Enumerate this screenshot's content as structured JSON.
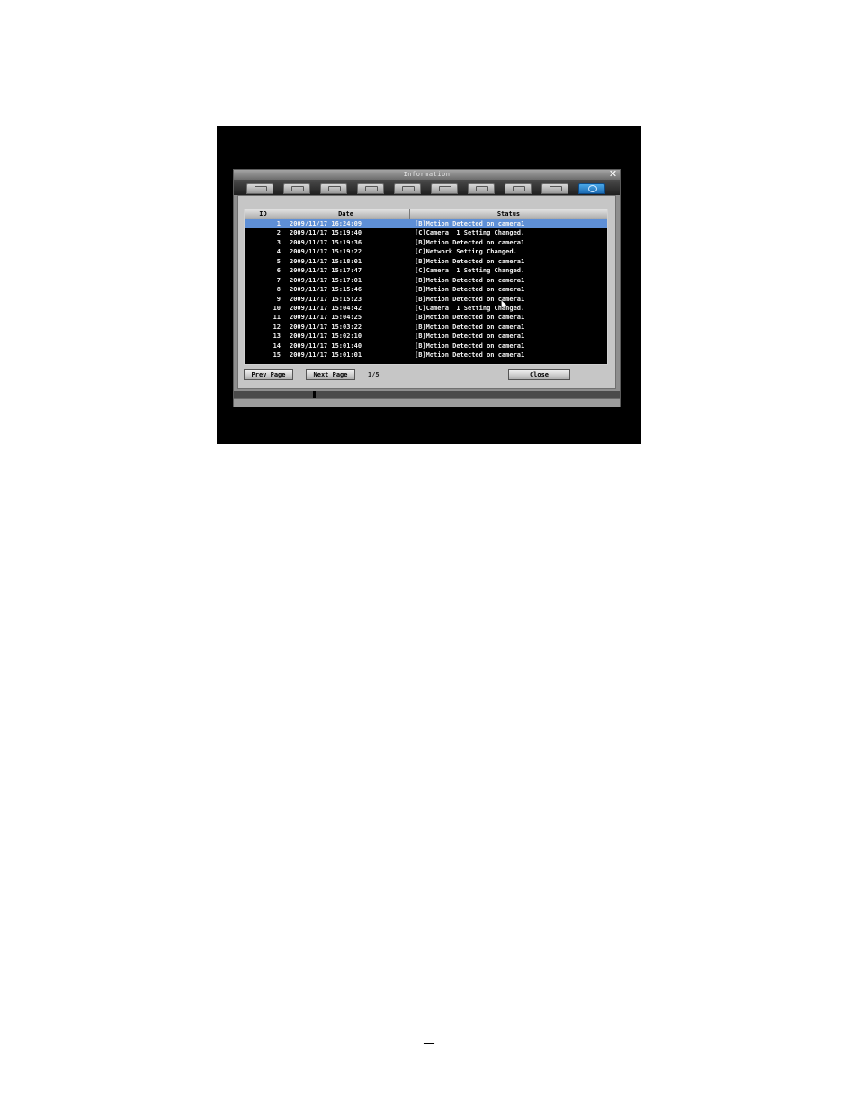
{
  "window": {
    "title": "Information",
    "close_icon": "close-icon"
  },
  "tabs": [
    {
      "name": "tab-camera",
      "icon": "camera-icon",
      "active": false
    },
    {
      "name": "tab-record",
      "icon": "record-icon",
      "active": false
    },
    {
      "name": "tab-keyboard",
      "icon": "keyboard-icon",
      "active": false
    },
    {
      "name": "tab-event",
      "icon": "event-icon",
      "active": false
    },
    {
      "name": "tab-display",
      "icon": "monitor-icon",
      "active": false
    },
    {
      "name": "tab-network",
      "icon": "network-icon",
      "active": false
    },
    {
      "name": "tab-disk",
      "icon": "disk-icon",
      "active": false
    },
    {
      "name": "tab-system",
      "icon": "system-icon",
      "active": false
    },
    {
      "name": "tab-tools",
      "icon": "tools-icon",
      "active": false
    },
    {
      "name": "tab-information",
      "icon": "info-icon",
      "active": true
    }
  ],
  "table": {
    "headers": {
      "id": "ID",
      "date": "Date",
      "status": "Status"
    },
    "rows": [
      {
        "id": "1",
        "date": "2009/11/17 16:24:09",
        "status": "[B]Motion Detected on camera1",
        "selected": true
      },
      {
        "id": "2",
        "date": "2009/11/17 15:19:40",
        "status": "[C]Camera  1 Setting Changed."
      },
      {
        "id": "3",
        "date": "2009/11/17 15:19:36",
        "status": "[B]Motion Detected on camera1"
      },
      {
        "id": "4",
        "date": "2009/11/17 15:19:22",
        "status": "[C]Network Setting Changed."
      },
      {
        "id": "5",
        "date": "2009/11/17 15:18:01",
        "status": "[B]Motion Detected on camera1"
      },
      {
        "id": "6",
        "date": "2009/11/17 15:17:47",
        "status": "[C]Camera  1 Setting Changed."
      },
      {
        "id": "7",
        "date": "2009/11/17 15:17:01",
        "status": "[B]Motion Detected on camera1"
      },
      {
        "id": "8",
        "date": "2009/11/17 15:15:46",
        "status": "[B]Motion Detected on camera1"
      },
      {
        "id": "9",
        "date": "2009/11/17 15:15:23",
        "status": "[B]Motion Detected on camera1"
      },
      {
        "id": "10",
        "date": "2009/11/17 15:04:42",
        "status": "[C]Camera  1 Setting Changed."
      },
      {
        "id": "11",
        "date": "2009/11/17 15:04:25",
        "status": "[B]Motion Detected on camera1"
      },
      {
        "id": "12",
        "date": "2009/11/17 15:03:22",
        "status": "[B]Motion Detected on camera1"
      },
      {
        "id": "13",
        "date": "2009/11/17 15:02:10",
        "status": "[B]Motion Detected on camera1"
      },
      {
        "id": "14",
        "date": "2009/11/17 15:01:40",
        "status": "[B]Motion Detected on camera1"
      },
      {
        "id": "15",
        "date": "2009/11/17 15:01:01",
        "status": "[B]Motion Detected on camera1"
      }
    ]
  },
  "buttons": {
    "prev": "Prev Page",
    "next": "Next Page",
    "close": "Close"
  },
  "pagination": {
    "indicator": "1/5"
  },
  "page_number": "__",
  "colors": {
    "selected_row": "#5e8fd6",
    "screen_bg": "#000000",
    "active_tab": "#1e6cb4"
  }
}
